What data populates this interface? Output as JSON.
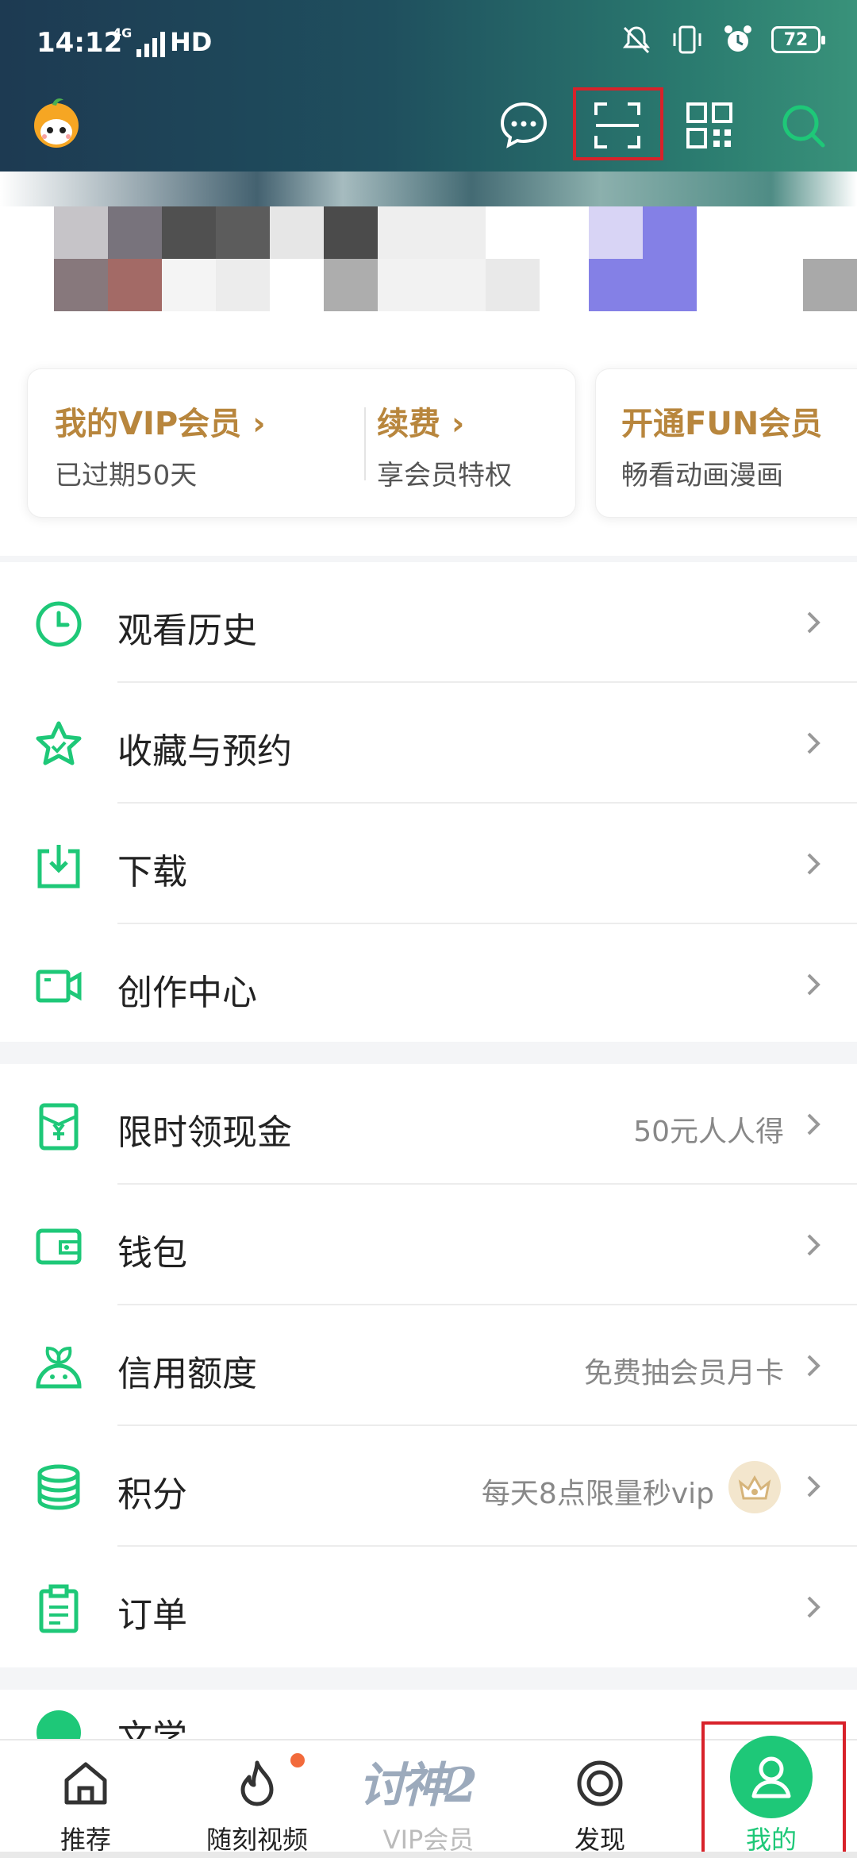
{
  "status_bar": {
    "time": "14:12",
    "signal": "4G",
    "hd": "HD",
    "battery": "72"
  },
  "header_icons": [
    "message-icon",
    "scan-icon",
    "qr-code-icon",
    "search-icon"
  ],
  "vip": {
    "my_vip_label": "我的VIP会员 ›",
    "my_vip_sub": "已过期50天",
    "renew_label": "续费 ›",
    "renew_sub": "享会员特权",
    "fun_label": "开通FUN会员",
    "fun_sub": "畅看动画漫画"
  },
  "menu_primary": [
    {
      "label": "观看历史",
      "icon": "clock-icon",
      "hint": ""
    },
    {
      "label": "收藏与预约",
      "icon": "star-icon",
      "hint": ""
    },
    {
      "label": "下载",
      "icon": "download-icon",
      "hint": ""
    },
    {
      "label": "创作中心",
      "icon": "video-camera-icon",
      "hint": ""
    }
  ],
  "menu_secondary": [
    {
      "label": "限时领现金",
      "icon": "red-envelope-icon",
      "hint": "50元人人得"
    },
    {
      "label": "钱包",
      "icon": "wallet-icon",
      "hint": ""
    },
    {
      "label": "信用额度",
      "icon": "sprout-icon",
      "hint": "免费抽会员月卡"
    },
    {
      "label": "积分",
      "icon": "coins-icon",
      "hint": "每天8点限量秒vip"
    },
    {
      "label": "订单",
      "icon": "clipboard-icon",
      "hint": ""
    }
  ],
  "menu_third_partial": {
    "label": "文学"
  },
  "bottom_nav": {
    "home": "推荐",
    "videos": "随刻视频",
    "vip": "VIP会员",
    "vip_art": "讨神2",
    "discover": "发现",
    "me": "我的"
  },
  "colors": {
    "accent_green": "#1ec878",
    "vip_gold": "#b8863d",
    "highlight_red": "#d8222a"
  }
}
